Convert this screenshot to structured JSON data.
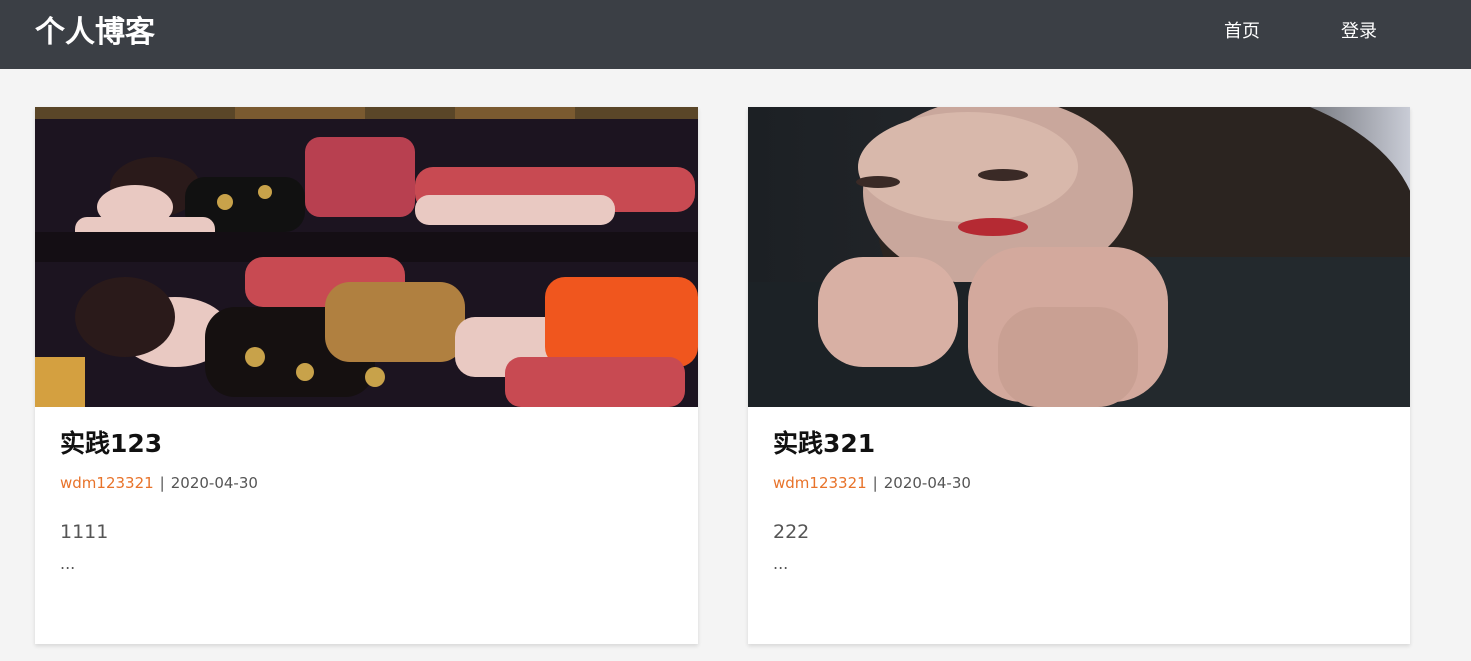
{
  "header": {
    "brand": "个人博客",
    "nav": [
      {
        "label": "首页"
      },
      {
        "label": "登录"
      }
    ]
  },
  "posts": [
    {
      "title": "实践123",
      "author": "wdm123321",
      "separator": "|",
      "date": "2020-04-30",
      "excerpt": "1111",
      "more": "..."
    },
    {
      "title": "实践321",
      "author": "wdm123321",
      "separator": "|",
      "date": "2020-04-30",
      "excerpt": "222",
      "more": "..."
    }
  ],
  "colors": {
    "navbar": "#3b3f45",
    "background": "#f4f4f4",
    "author": "#e8732a"
  }
}
